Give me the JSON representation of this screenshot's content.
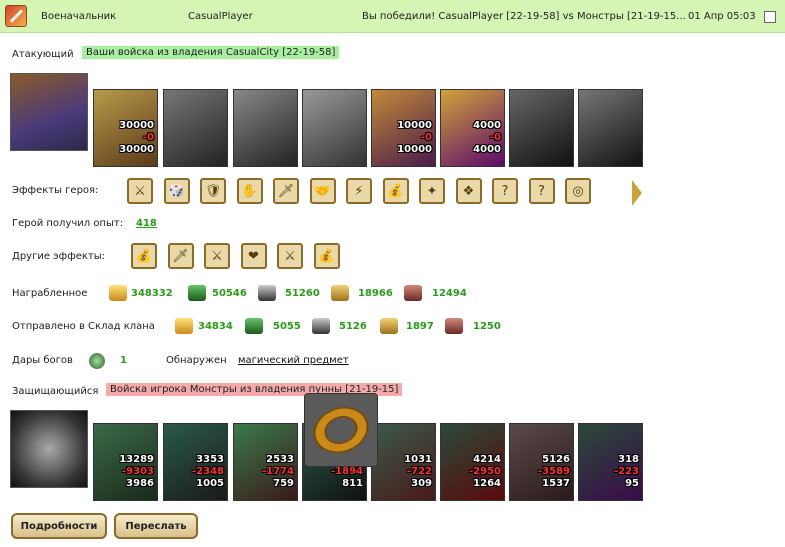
{
  "header": {
    "title": "Военачальник",
    "player": "CasualPlayer",
    "result": "Вы победили! CasualPlayer [22-19-58] vs Монстры [21-19-15...",
    "date": "01 Апр 05:03"
  },
  "attacker": {
    "label": "Атакующий",
    "tag": "Ваши войска из владения CasualCity [22-19-58]",
    "units": [
      {
        "a": "30000",
        "b": "-0",
        "c": "30000"
      },
      {
        "a": "",
        "b": "",
        "c": ""
      },
      {
        "a": "",
        "b": "",
        "c": ""
      },
      {
        "a": "",
        "b": "",
        "c": ""
      },
      {
        "a": "10000",
        "b": "-0",
        "c": "10000"
      },
      {
        "a": "4000",
        "b": "-0",
        "c": "4000"
      },
      {
        "a": "",
        "b": "",
        "c": ""
      },
      {
        "a": "",
        "b": "",
        "c": ""
      }
    ]
  },
  "hero_effects": {
    "label": "Эффекты героя:",
    "icons": [
      "⚔",
      "🎲",
      "🛡",
      "✋",
      "🗡",
      "🤝",
      "⚡",
      "💰",
      "✦",
      "❖",
      "?",
      "?",
      "◎"
    ]
  },
  "experience": {
    "label": "Герой получил опыт:",
    "value": "418"
  },
  "other_effects": {
    "label": "Другие эффекты:",
    "icons": [
      "💰",
      "🗡",
      "⚔",
      "❤",
      "⚔",
      "💰"
    ]
  },
  "loot": {
    "label": "Награбленное",
    "values": [
      "348332",
      "50546",
      "51260",
      "18966",
      "12494"
    ]
  },
  "sent": {
    "label": "Отправлено в Склад клана",
    "values": [
      "34834",
      "5055",
      "5126",
      "1897",
      "1250"
    ]
  },
  "gifts": {
    "label": "Дары богов",
    "value": "1",
    "found_label": "Обнаружен",
    "found_link": "магический предмет"
  },
  "defender": {
    "label": "Защищающийся",
    "tag": "Войска игрока Монстры из владения пунны [21-19-15]",
    "units": [
      {
        "a": "13289",
        "b": "-9303",
        "c": "3986"
      },
      {
        "a": "3353",
        "b": "-2348",
        "c": "1005"
      },
      {
        "a": "2533",
        "b": "-1774",
        "c": "759"
      },
      {
        "a": "2705",
        "b": "-1894",
        "c": "811"
      },
      {
        "a": "1031",
        "b": "-722",
        "c": "309"
      },
      {
        "a": "4214",
        "b": "-2950",
        "c": "1264"
      },
      {
        "a": "5126",
        "b": "-3589",
        "c": "1537"
      },
      {
        "a": "318",
        "b": "-223",
        "c": "95"
      }
    ]
  },
  "buttons": {
    "details": "Подробности",
    "forward": "Переслать"
  },
  "colors": {
    "header_bg": "#d4f5b4",
    "value_green": "#2a9a1a",
    "loss_red": "#ff3030"
  }
}
